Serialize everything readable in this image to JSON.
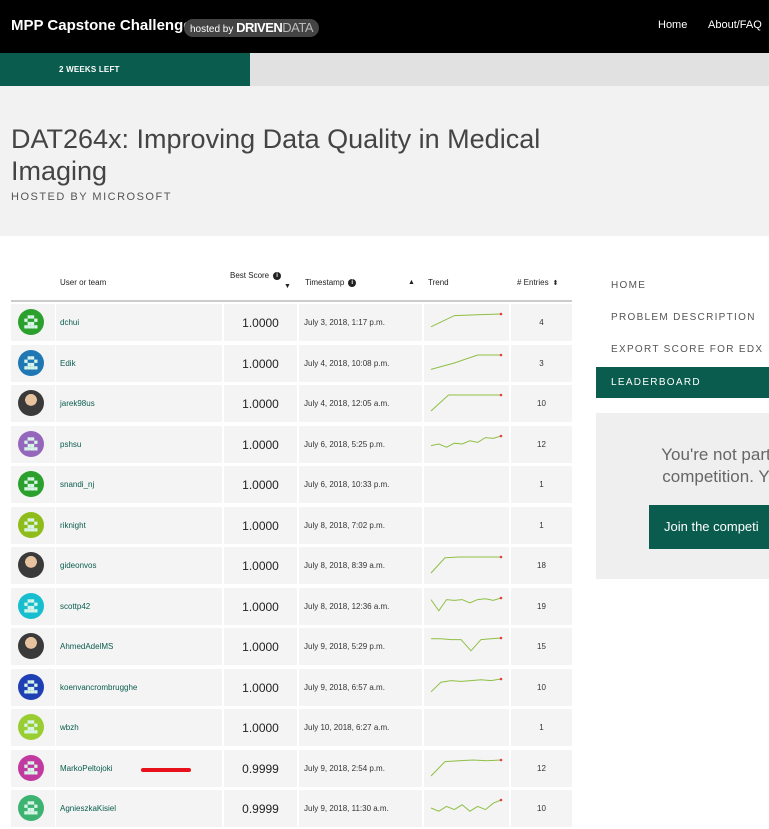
{
  "topbar": {
    "brand": "MPP Capstone Challenge",
    "hosted_by": "hosted by",
    "hosted_brand_bold": "DRIVEN",
    "hosted_brand_light": "DATA",
    "nav": [
      "Home",
      "About/FAQ"
    ]
  },
  "progress": {
    "label": "2 WEEKS LEFT",
    "fraction": 0.325,
    "color": "#0a5c4e"
  },
  "header": {
    "title": "DAT264x: Improving Data Quality in Medical Imaging",
    "hosted": "HOSTED BY MICROSOFT"
  },
  "leaderboard": {
    "columns": {
      "user": "User or team",
      "score": "Best Score",
      "timestamp": "Timestamp",
      "trend": "Trend",
      "entries": "# Entries"
    },
    "rows": [
      {
        "user": "dchui",
        "score": "1.0000",
        "timestamp": "July 3, 2018, 1:17 p.m.",
        "entries": "4",
        "avatar": "#2ca02c",
        "trend": [
          0.2,
          0.9,
          0.95,
          1.0
        ]
      },
      {
        "user": "Edik",
        "score": "1.0000",
        "timestamp": "July 4, 2018, 10:08 p.m.",
        "entries": "3",
        "avatar": "#1f77b4",
        "trend": [
          0.1,
          0.5,
          1.0,
          1.0
        ]
      },
      {
        "user": "jarek98us",
        "score": "1.0000",
        "timestamp": "July 4, 2018, 12:05 a.m.",
        "entries": "10",
        "avatar": "photo",
        "trend": [
          0.0,
          1.0,
          1.0,
          1.0,
          1.0
        ]
      },
      {
        "user": "pshsu",
        "score": "1.0000",
        "timestamp": "July 6, 2018, 5:25 p.m.",
        "entries": "12",
        "avatar": "#9467bd",
        "trend": [
          0.4,
          0.5,
          0.3,
          0.55,
          0.5,
          0.7,
          0.6,
          0.9,
          0.85,
          1.0
        ]
      },
      {
        "user": "snandi_nj",
        "score": "1.0000",
        "timestamp": "July 6, 2018, 10:33 p.m.",
        "entries": "1",
        "avatar": "#2ca02c",
        "trend": []
      },
      {
        "user": "riknight",
        "score": "1.0000",
        "timestamp": "July 8, 2018, 7:02 p.m.",
        "entries": "1",
        "avatar": "#8fbc1a",
        "trend": []
      },
      {
        "user": "gideonvos",
        "score": "1.0000",
        "timestamp": "July 8, 2018, 8:39 a.m.",
        "entries": "18",
        "avatar": "photo",
        "trend": [
          0.0,
          0.95,
          1.0,
          1.0,
          1.0,
          1.0
        ]
      },
      {
        "user": "scottp42",
        "score": "1.0000",
        "timestamp": "July 8, 2018, 12:36 a.m.",
        "entries": "19",
        "avatar": "#17becf",
        "trend": [
          0.9,
          0.2,
          0.9,
          0.85,
          0.9,
          0.7,
          0.9,
          0.95,
          0.85,
          1.0
        ]
      },
      {
        "user": "AhmedAdelMS",
        "score": "1.0000",
        "timestamp": "July 9, 2018, 5:29 p.m.",
        "entries": "15",
        "avatar": "photo",
        "trend": [
          0.95,
          0.95,
          0.9,
          0.9,
          0.2,
          0.9,
          0.95,
          1.0
        ]
      },
      {
        "user": "koenvancrombrugghe",
        "score": "1.0000",
        "timestamp": "July 9, 2018, 6:57 a.m.",
        "entries": "10",
        "avatar": "#1f3fb4",
        "trend": [
          0.2,
          0.8,
          0.9,
          0.85,
          0.9,
          0.95,
          0.9,
          1.0
        ]
      },
      {
        "user": "wbzh",
        "score": "1.0000",
        "timestamp": "July 10, 2018, 6:27 a.m.",
        "entries": "1",
        "avatar": "#9acd32",
        "trend": []
      },
      {
        "user": "MarkoPeltojoki",
        "score": "0.9999",
        "timestamp": "July 9, 2018, 2:54 p.m.",
        "entries": "12",
        "avatar": "#c23aa0",
        "trend": [
          0.0,
          0.9,
          0.95,
          1.0,
          0.95,
          1.0
        ]
      },
      {
        "user": "AgnieszkaKisiel",
        "score": "0.9999",
        "timestamp": "July 9, 2018, 11:30 a.m.",
        "entries": "10",
        "avatar": "#3cb371",
        "trend": [
          0.5,
          0.3,
          0.6,
          0.4,
          0.7,
          0.3,
          0.6,
          0.4,
          0.8,
          1.0
        ]
      }
    ]
  },
  "sidenav": {
    "items": [
      "HOME",
      "PROBLEM DESCRIPTION",
      "EXPORT SCORE FOR EDX",
      "LEADERBOARD"
    ],
    "active_index": 3
  },
  "join": {
    "line1": "You're not part",
    "line2": "competition. Y",
    "button": "Join the competi"
  },
  "colors": {
    "accent": "#0a5c4e",
    "trend_line": "#8fbf45",
    "trend_end": "#e0413a",
    "highlight": "#e8111b"
  }
}
